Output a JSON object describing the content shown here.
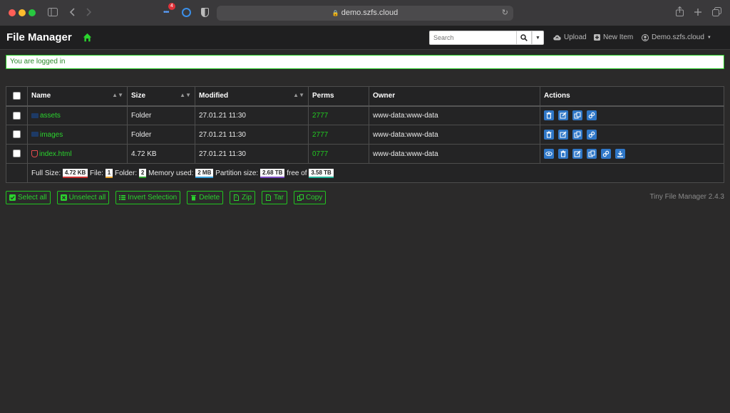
{
  "browser": {
    "address": "demo.szfs.cloud",
    "extension_badge": "4"
  },
  "navbar": {
    "brand": "File Manager",
    "search_placeholder": "Search",
    "upload_label": "Upload",
    "new_item_label": "New Item",
    "user_label": "Demo.szfs.cloud"
  },
  "alert": {
    "text": "You are logged in"
  },
  "table": {
    "headers": {
      "name": "Name",
      "size": "Size",
      "modified": "Modified",
      "perms": "Perms",
      "owner": "Owner",
      "actions": "Actions"
    },
    "rows": [
      {
        "name": "assets",
        "size": "Folder",
        "modified": "27.01.21 11:30",
        "perms": "2777",
        "owner": "www-data:www-data",
        "type": "folder"
      },
      {
        "name": "images",
        "size": "Folder",
        "modified": "27.01.21 11:30",
        "perms": "2777",
        "owner": "www-data:www-data",
        "type": "folder"
      },
      {
        "name": "index.html",
        "size": "4.72 KB",
        "modified": "27.01.21 11:30",
        "perms": "0777",
        "owner": "www-data:www-data",
        "type": "file"
      }
    ],
    "footer": {
      "full_size_label": "Full Size:",
      "full_size": "4.72 KB",
      "file_label": "File:",
      "file_count": "1",
      "folder_label": "Folder:",
      "folder_count": "2",
      "memory_label": "Memory used:",
      "memory": "2 MB",
      "partition_label": "Partition size:",
      "partition": "2.68 TB",
      "free_of_label": "free of",
      "total": "3.58 TB"
    }
  },
  "actions": {
    "select_all": "Select all",
    "unselect_all": "Unselect all",
    "invert_selection": "Invert Selection",
    "delete": "Delete",
    "zip": "Zip",
    "tar": "Tar",
    "copy": "Copy"
  },
  "version": "Tiny File Manager 2.4.3",
  "colors": {
    "accent_green": "#2bd32e",
    "action_blue": "#2f77c7",
    "background": "#2b2a2a"
  }
}
